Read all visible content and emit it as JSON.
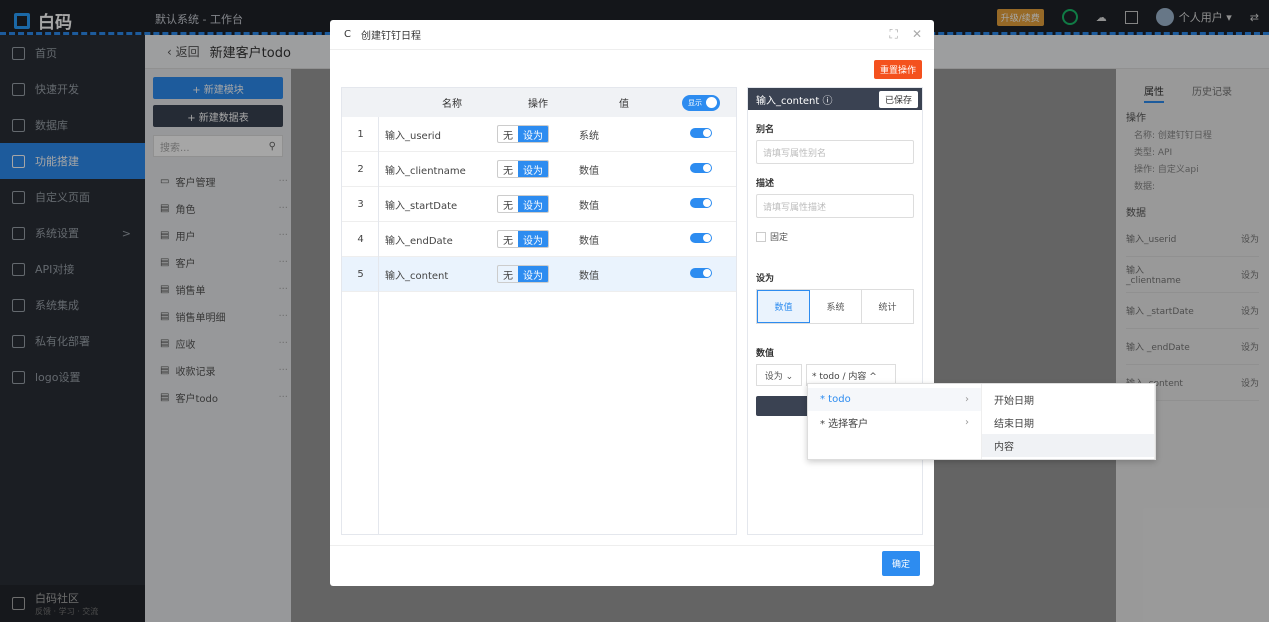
{
  "topbar": {
    "brand": "白码",
    "breadcrumb": "默认系统 - 工作台",
    "upgrade_label": "升级/续费",
    "user_label": "个人用户 ▾",
    "switch_glyph": "⇄"
  },
  "sidebar": {
    "items": [
      {
        "label": "首页",
        "icon": "home-icon"
      },
      {
        "label": "快速开发",
        "icon": "rocket-icon"
      },
      {
        "label": "数据库",
        "icon": "database-icon"
      },
      {
        "label": "功能搭建",
        "icon": "build-icon"
      },
      {
        "label": "自定义页面",
        "icon": "page-icon"
      },
      {
        "label": "系统设置",
        "icon": "settings-icon",
        "arrow": ">"
      },
      {
        "label": "API对接",
        "icon": "api-icon"
      },
      {
        "label": "系统集成",
        "icon": "integration-icon"
      },
      {
        "label": "私有化部署",
        "icon": "deploy-icon"
      },
      {
        "label": "logo设置",
        "icon": "logo-icon"
      }
    ],
    "active_index": 3,
    "community": {
      "title": "白码社区",
      "sub": "反馈 · 学习 · 交流"
    }
  },
  "backbar": {
    "back_label": "返回",
    "title": "新建客户todo"
  },
  "modulepanel": {
    "new_module": "+ 新建模块",
    "new_table": "+ 新建数据表",
    "search_placeholder": "搜索...",
    "tree": [
      "客户管理",
      "角色",
      "用户",
      "客户",
      "销售单",
      "销售单明细",
      "应收",
      "收款记录",
      "客户todo"
    ],
    "dots": "···"
  },
  "rightpanel": {
    "tab_attr": "属性",
    "tab_history": "历史记录",
    "section_op": "操作",
    "kv": [
      "名称: 创建钉钉日程",
      "类型: API",
      "操作: 自定义api",
      "数据:"
    ],
    "section_data": "数据",
    "rows": [
      {
        "k": "输入_userid",
        "v": "设为"
      },
      {
        "k": "输入 _clientname",
        "v": "设为"
      },
      {
        "k": "输入 _startDate",
        "v": "设为"
      },
      {
        "k": "输入 _endDate",
        "v": "设为"
      },
      {
        "k": "输入_content",
        "v": "设为"
      }
    ]
  },
  "modal": {
    "title": "创建钉钉日程",
    "refresh_glyph": "C",
    "expand_glyph": "⛶",
    "close_glyph": "✕",
    "reset_label": "重置操作",
    "columns": {
      "name": "名称",
      "op": "操作",
      "value": "值",
      "show": "显示"
    },
    "rows": [
      {
        "idx": "1",
        "name": "输入_userid",
        "off": "无",
        "on": "设为",
        "value": "系统"
      },
      {
        "idx": "2",
        "name": "输入_clientname",
        "off": "无",
        "on": "设为",
        "value": "数值"
      },
      {
        "idx": "3",
        "name": "输入_startDate",
        "off": "无",
        "on": "设为",
        "value": "数值"
      },
      {
        "idx": "4",
        "name": "输入_endDate",
        "off": "无",
        "on": "设为",
        "value": "数值"
      },
      {
        "idx": "5",
        "name": "输入_content",
        "off": "无",
        "on": "设为",
        "value": "数值"
      }
    ],
    "selected_row": 4,
    "confirm_label": "确定"
  },
  "prop": {
    "title": "输入_content ⓘ",
    "saved": "已保存",
    "alias_label": "别名",
    "alias_placeholder": "请填写属性别名",
    "desc_label": "描述",
    "desc_placeholder": "请填写属性描述",
    "fixed_label": "固定",
    "setas_label": "设为",
    "setas_options": [
      "数值",
      "系统",
      "统计"
    ],
    "setas_selected": 0,
    "value_label": "数值",
    "value_select": "设为  ⌄",
    "value_path": "* todo / 内容 ^"
  },
  "cascade": {
    "level1": [
      {
        "label": "* todo",
        "arrow": "›"
      },
      {
        "label": "* 选择客户",
        "arrow": "›"
      }
    ],
    "level1_selected": 0,
    "level2": [
      "开始日期",
      "结束日期",
      "内容"
    ],
    "level2_highlighted": 2
  },
  "colors": {
    "accent": "#2d8cf0",
    "danger": "#f4511e",
    "dark": "#2a2f36"
  }
}
